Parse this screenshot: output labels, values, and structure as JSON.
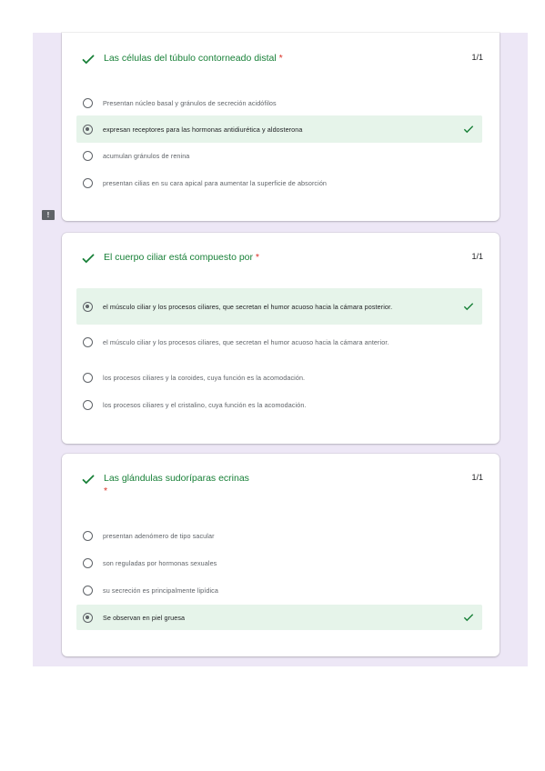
{
  "questions": [
    {
      "title": "Las células del túbulo contorneado distal",
      "required_mark": "*",
      "score": "1/1",
      "options": [
        {
          "text": "Presentan núcleo basal y gránulos de secreción acidófilos",
          "selected": false,
          "correct": false
        },
        {
          "text": "expresan receptores para las hormonas antidiurética y aldosterona",
          "selected": true,
          "correct": true
        },
        {
          "text": "acumulan gránulos de renina",
          "selected": false,
          "correct": false
        },
        {
          "text": "presentan cilias en su cara apical para aumentar la superficie de absorción",
          "selected": false,
          "correct": false
        }
      ]
    },
    {
      "title": "El cuerpo ciliar está compuesto por",
      "required_mark": "*",
      "score": "1/1",
      "options": [
        {
          "text": "el músculo ciliar y los procesos ciliares, que secretan el humor acuoso hacia la cámara posterior.",
          "selected": true,
          "correct": true
        },
        {
          "text": "el músculo ciliar y los procesos ciliares, que secretan el humor acuoso hacia la cámara anterior.",
          "selected": false,
          "correct": false
        },
        {
          "text": "los procesos ciliares y la coroides, cuya función es la acomodación.",
          "selected": false,
          "correct": false
        },
        {
          "text": "los procesos ciliares y el cristalino, cuya función es la acomodación.",
          "selected": false,
          "correct": false
        }
      ]
    },
    {
      "title": "Las glándulas sudoríparas ecrinas",
      "required_mark": "*",
      "score": "1/1",
      "options": [
        {
          "text": "presentan adenómero de tipo sacular",
          "selected": false,
          "correct": false
        },
        {
          "text": "son reguladas por hormonas sexuales",
          "selected": false,
          "correct": false
        },
        {
          "text": "su secreción es principalmente lipídica",
          "selected": false,
          "correct": false
        },
        {
          "text": "Se observan en piel gruesa",
          "selected": true,
          "correct": true
        }
      ]
    }
  ],
  "feedback_icon": "!",
  "colors": {
    "correct": "#188038",
    "required": "#d93025",
    "selected_bg": "#e6f4ea",
    "panel_bg": "#ede7f6"
  },
  "icons": {
    "question_status": "checkmark-icon",
    "answer_status": "checkmark-icon",
    "feedback": "feedback-icon"
  }
}
